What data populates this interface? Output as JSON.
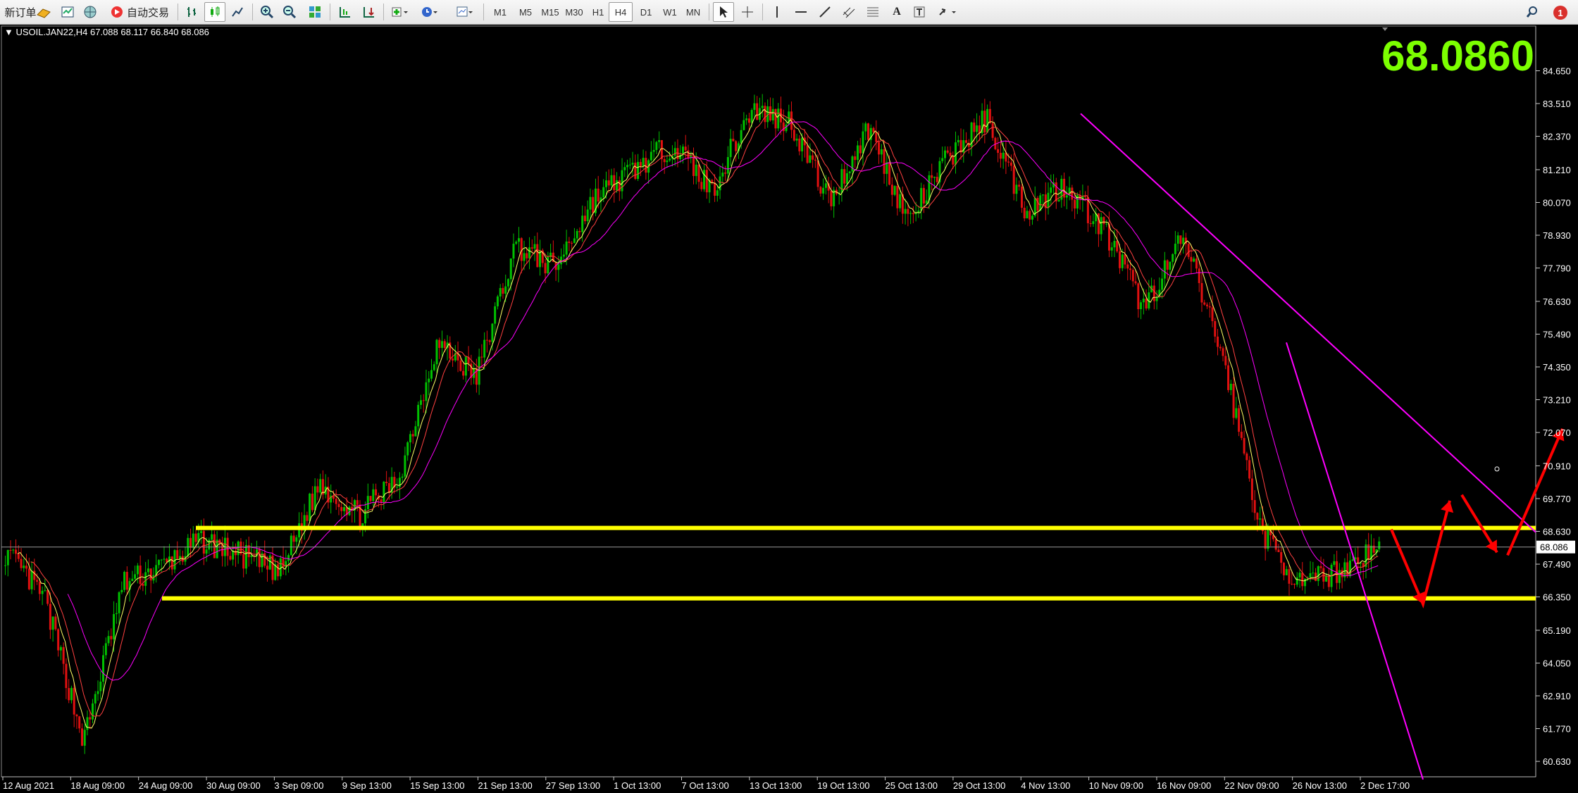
{
  "toolbar": {
    "new_order_label": "新订单",
    "auto_trade_label": "自动交易",
    "timeframes": [
      "M1",
      "M5",
      "M15",
      "M30",
      "H1",
      "H4",
      "D1",
      "W1",
      "MN"
    ],
    "active_timeframe": "H4",
    "notification_count": "1"
  },
  "chart": {
    "symbol_line": "USOIL.JAN22,H4  67.088 68.117 66.840 68.086",
    "big_price": "68.0860",
    "current_price_label": "68.086",
    "price_ticks": [
      "84.650",
      "83.510",
      "82.370",
      "81.210",
      "80.070",
      "78.930",
      "77.790",
      "76.630",
      "75.490",
      "74.350",
      "73.210",
      "72.070",
      "70.910",
      "69.770",
      "68.630",
      "67.490",
      "66.350",
      "65.190",
      "64.050",
      "62.910",
      "61.770",
      "60.630"
    ],
    "time_ticks": [
      "12 Aug 2021",
      "18 Aug 09:00",
      "24 Aug 09:00",
      "30 Aug 09:00",
      "3 Sep 09:00",
      "9 Sep 13:00",
      "15 Sep 13:00",
      "21 Sep 13:00",
      "27 Sep 13:00",
      "1 Oct 13:00",
      "7 Oct 13:00",
      "13 Oct 13:00",
      "19 Oct 13:00",
      "25 Oct 13:00",
      "29 Oct 13:00",
      "4 Nov 13:00",
      "10 Nov 09:00",
      "16 Nov 09:00",
      "22 Nov 09:00",
      "26 Nov 13:00",
      "2 Dec 17:00"
    ],
    "colors": {
      "up": "#00c000",
      "down": "#e01010",
      "support": "#ffff00",
      "trend": "#ff00ff",
      "arrow": "#ff0000",
      "price_big": "#7cff00"
    }
  },
  "chart_data": {
    "type": "candlestick",
    "title": "USOIL.JAN22,H4",
    "ohlc_last": {
      "open": 67.088,
      "high": 68.117,
      "low": 66.84,
      "close": 68.086
    },
    "ylim": [
      60.0,
      85.1
    ],
    "x": [
      "12 Aug 2021",
      "18 Aug 09:00",
      "24 Aug 09:00",
      "30 Aug 09:00",
      "3 Sep 09:00",
      "9 Sep 13:00",
      "15 Sep 13:00",
      "21 Sep 13:00",
      "27 Sep 13:00",
      "1 Oct 13:00",
      "7 Oct 13:00",
      "13 Oct 13:00",
      "19 Oct 13:00",
      "25 Oct 13:00",
      "29 Oct 13:00",
      "4 Nov 13:00",
      "10 Nov 09:00",
      "16 Nov 09:00",
      "22 Nov 09:00",
      "26 Nov 13:00",
      "2 Dec 17:00"
    ],
    "close_series": [
      67.9,
      66.3,
      61.3,
      66.8,
      67.4,
      68.3,
      67.8,
      67.2,
      70.3,
      69.2,
      70.4,
      75.2,
      74.0,
      78.6,
      77.8,
      80.2,
      81.2,
      82.1,
      80.5,
      83.3,
      82.9,
      80.1,
      82.7,
      79.4,
      81.6,
      83.0,
      79.8,
      80.7,
      79.1,
      76.4,
      78.8,
      74.8,
      68.6,
      66.7,
      67.3,
      68.1
    ],
    "support_levels": [
      68.75,
      66.3
    ],
    "current_price": 68.086
  }
}
